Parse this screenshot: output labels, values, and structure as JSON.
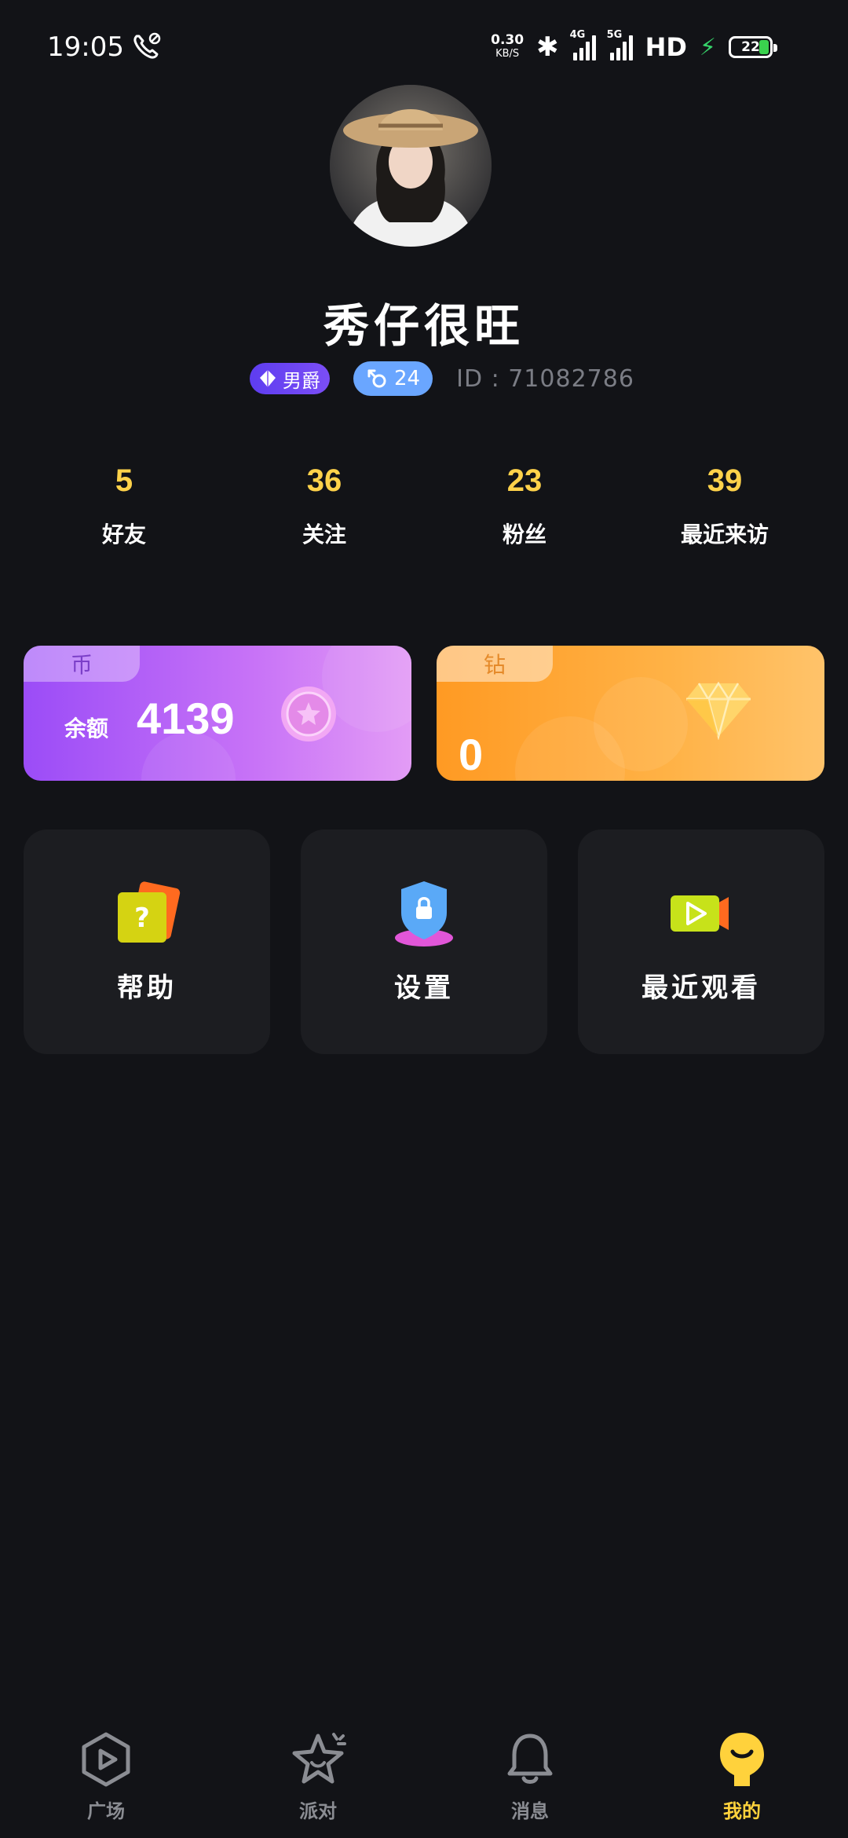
{
  "status_bar": {
    "time": "19:05",
    "net_speed_value": "0.30",
    "net_speed_unit": "KB/S",
    "sim1_label": "4G",
    "sim2_label": "5G",
    "hd_label": "HD",
    "battery": "22"
  },
  "profile": {
    "nickname": "秀仔很旺",
    "rank_badge": "男爵",
    "age_badge": "24",
    "user_id": "ID : 71082786"
  },
  "stats": [
    {
      "value": "5",
      "label": "好友"
    },
    {
      "value": "36",
      "label": "关注"
    },
    {
      "value": "23",
      "label": "粉丝"
    },
    {
      "value": "39",
      "label": "最近来访"
    }
  ],
  "wallet": {
    "coin_tag": "币",
    "coin_label": "余额",
    "coin_amount": "4139",
    "diamond_tag": "钻",
    "diamond_amount": "0"
  },
  "tiles": [
    {
      "label": "帮助",
      "icon": "help-icon"
    },
    {
      "label": "设置",
      "icon": "settings-shield-icon"
    },
    {
      "label": "最近观看",
      "icon": "video-camera-icon"
    }
  ],
  "tabbar": [
    {
      "label": "广场",
      "icon": "play-hexagon-icon",
      "active": false
    },
    {
      "label": "派对",
      "icon": "star-icon",
      "active": false
    },
    {
      "label": "消息",
      "icon": "bell-icon",
      "active": false
    },
    {
      "label": "我的",
      "icon": "mascot-icon",
      "active": true
    }
  ],
  "colors": {
    "background": "#121317",
    "stat_number": "#ffd24a",
    "coin_card": "#9b4cf7",
    "diamond_card": "#ff9a23",
    "tab_active": "#ffd23c",
    "tab_inactive": "#8b8d93"
  }
}
